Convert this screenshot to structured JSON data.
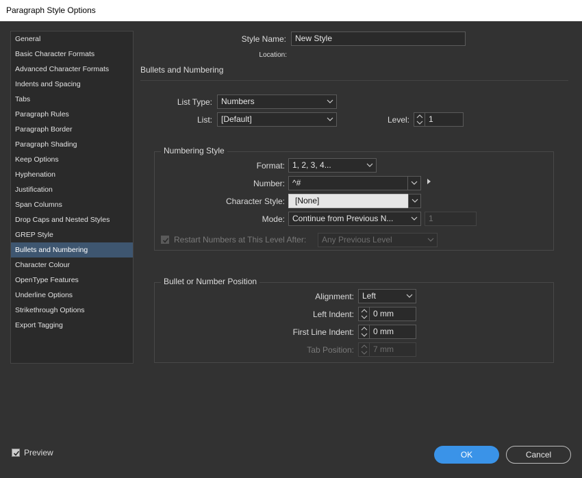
{
  "window": {
    "title": "Paragraph Style Options"
  },
  "sidebar": {
    "items": [
      {
        "label": "General"
      },
      {
        "label": "Basic Character Formats"
      },
      {
        "label": "Advanced Character Formats"
      },
      {
        "label": "Indents and Spacing"
      },
      {
        "label": "Tabs"
      },
      {
        "label": "Paragraph Rules"
      },
      {
        "label": "Paragraph Border"
      },
      {
        "label": "Paragraph Shading"
      },
      {
        "label": "Keep Options"
      },
      {
        "label": "Hyphenation"
      },
      {
        "label": "Justification"
      },
      {
        "label": "Span Columns"
      },
      {
        "label": "Drop Caps and Nested Styles"
      },
      {
        "label": "GREP Style"
      },
      {
        "label": "Bullets and Numbering"
      },
      {
        "label": "Character Colour"
      },
      {
        "label": "OpenType Features"
      },
      {
        "label": "Underline Options"
      },
      {
        "label": "Strikethrough Options"
      },
      {
        "label": "Export Tagging"
      }
    ],
    "selected": "Bullets and Numbering"
  },
  "header": {
    "style_name_label": "Style Name:",
    "style_name_value": "New Style",
    "location_label": "Location:",
    "section_title": "Bullets and Numbering"
  },
  "list": {
    "list_type_label": "List Type:",
    "list_type_value": "Numbers",
    "list_label": "List:",
    "list_value": "[Default]",
    "level_label": "Level:",
    "level_value": "1"
  },
  "numbering_style": {
    "group_title": "Numbering Style",
    "format_label": "Format:",
    "format_value": "1, 2, 3, 4...",
    "number_label": "Number:",
    "number_value": "^#",
    "char_style_label": "Character Style:",
    "char_style_value": "[None]",
    "mode_label": "Mode:",
    "mode_value": "Continue from Previous N...",
    "mode_number": "1",
    "restart_label": "Restart Numbers at This Level After:",
    "restart_checked": true,
    "restart_value": "Any Previous Level"
  },
  "position": {
    "group_title": "Bullet or Number Position",
    "alignment_label": "Alignment:",
    "alignment_value": "Left",
    "left_indent_label": "Left Indent:",
    "left_indent_value": "0 mm",
    "first_line_label": "First Line Indent:",
    "first_line_value": "0 mm",
    "tab_position_label": "Tab Position:",
    "tab_position_value": "7 mm"
  },
  "footer": {
    "preview_label": "Preview",
    "preview_checked": true,
    "ok_label": "OK",
    "cancel_label": "Cancel"
  },
  "colors": {
    "accent": "#3a93e8",
    "selection": "#3e5670",
    "background": "#323232"
  }
}
